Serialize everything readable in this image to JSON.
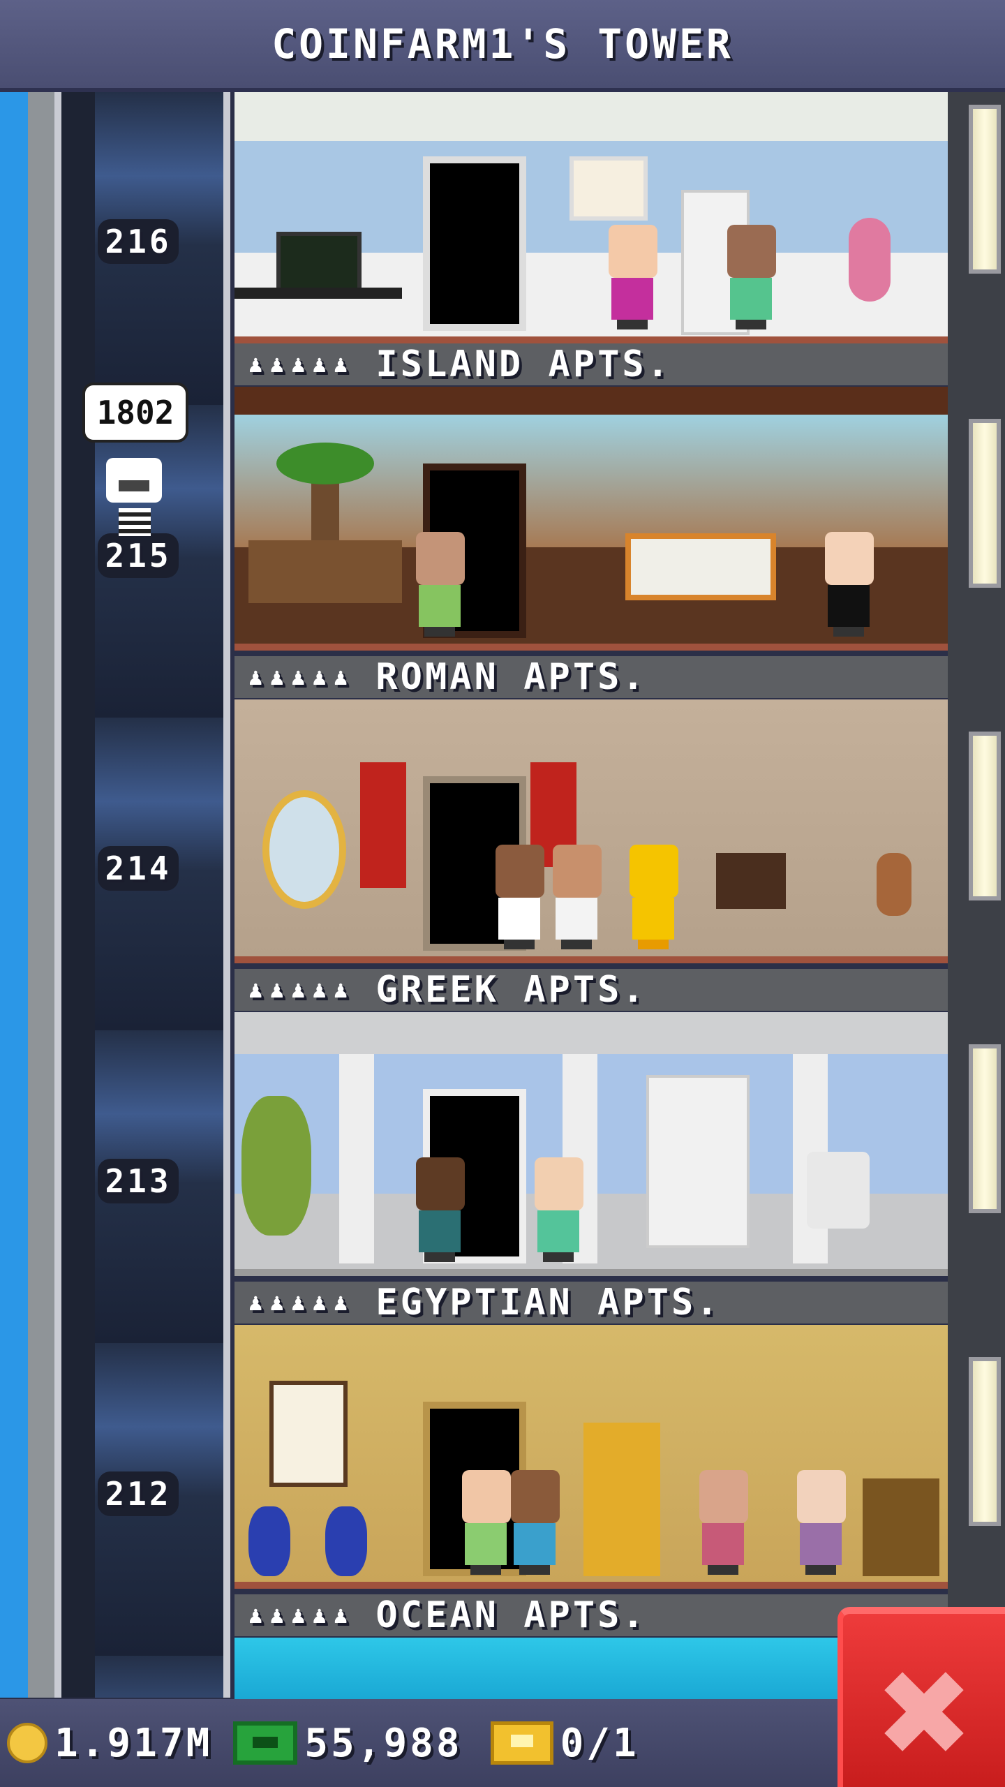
{
  "header": {
    "title": "COINFARM1'S TOWER"
  },
  "elevator": {
    "bubble_text": "1802"
  },
  "floor_numbers": [
    "216",
    "215",
    "214",
    "213",
    "212"
  ],
  "banners": [
    {
      "stars": "♟♟♟♟♟",
      "label": "ISLAND APTS."
    },
    {
      "stars": "♟♟♟♟♟",
      "label": "ROMAN APTS."
    },
    {
      "stars": "♟♟♟♟♟",
      "label": "GREEK APTS."
    },
    {
      "stars": "♟♟♟♟♟",
      "label": "EGYPTIAN APTS."
    },
    {
      "stars": "♟♟♟♟♟",
      "label": "OCEAN APTS."
    }
  ],
  "status_bar": {
    "coins": "1.917M",
    "bux": "55,988",
    "tickets": "0/1"
  },
  "icons": {
    "coin": "coin-icon",
    "bux": "tower-bux-icon",
    "ticket": "vip-ticket-icon",
    "close": "close-icon"
  },
  "colors": {
    "close_button": "#d92a2a",
    "header_bg": "#5d6188",
    "elevator_shaft": "#3f5b8e"
  }
}
